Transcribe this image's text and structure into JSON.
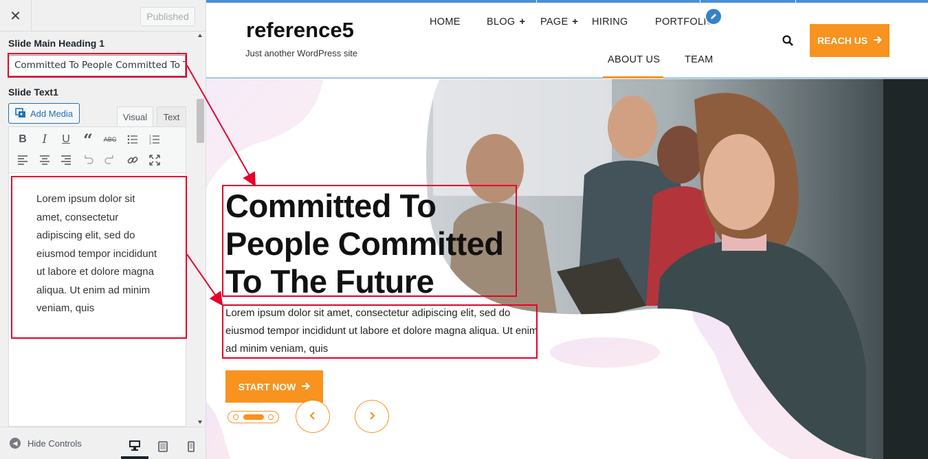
{
  "sidebar": {
    "close_label": "✕",
    "published_label": "Published",
    "heading_label": "Slide Main Heading 1",
    "heading_value": "Committed To People Committed To T",
    "text_label": "Slide Text1",
    "add_media_label": "Add Media",
    "tab_visual": "Visual",
    "tab_text": "Text",
    "editor_content": "Lorem ipsum dolor sit amet, consectetur adipiscing elit, sed do eiusmod tempor incididunt ut labore et dolore magna aliqua. Ut enim ad minim veniam, quis",
    "hide_controls_label": "Hide Controls",
    "toolbar_icons": [
      "bold-icon",
      "italic-icon",
      "underline-icon",
      "blockquote-icon",
      "strikethrough-icon",
      "bullet-list-icon",
      "numbered-list-icon",
      "align-left-icon",
      "align-center-icon",
      "align-right-icon",
      "undo-icon",
      "redo-icon",
      "link-icon",
      "fullscreen-icon"
    ]
  },
  "site": {
    "title": "reference5",
    "tagline": "Just another WordPress site",
    "nav": {
      "home": "HOME",
      "blog": "BLOG",
      "page": "PAGE",
      "hiring": "HIRING",
      "portfolio": "PORTFOLIO",
      "about": "ABOUT US",
      "team": "TEAM"
    },
    "plus": "+",
    "reach_label": "REACH US",
    "accent_color": "#f7931e",
    "link_color": "#4a8fd8"
  },
  "hero": {
    "heading": "Committed To People Committed To The Future",
    "text": "Lorem ipsum dolor sit amet, consectetur adipiscing elit, sed do eiusmod tempor incididunt ut labore et dolore magna aliqua. Ut enim ad minim veniam, quis",
    "start_label": "START NOW",
    "prev_arrow": "‹",
    "next_arrow": "›"
  }
}
